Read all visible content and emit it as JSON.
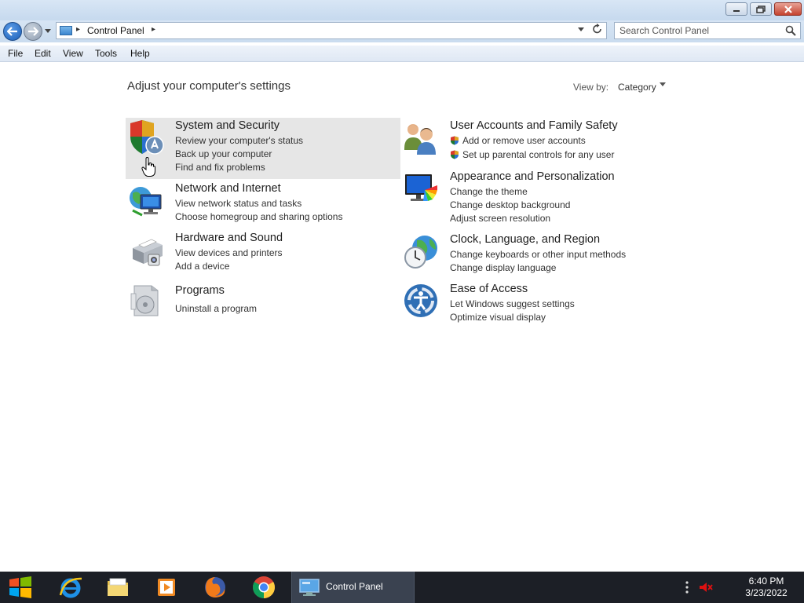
{
  "window": {
    "minimize_icon": "minimize-icon",
    "maximize_icon": "restore-icon",
    "close_icon": "close-icon"
  },
  "nav": {
    "back_icon": "back-arrow-icon",
    "forward_icon": "forward-arrow-icon",
    "recent_icon": "chevron-down-icon",
    "breadcrumb": "Control Panel",
    "refresh_icon": "refresh-icon",
    "search_placeholder": "Search Control Panel",
    "search_value": ""
  },
  "menu": {
    "items": [
      "File",
      "Edit",
      "View",
      "Tools",
      "Help"
    ]
  },
  "main": {
    "heading": "Adjust your computer's settings",
    "view_by_label": "View by:",
    "view_by_value": "Category",
    "categories": [
      {
        "title": "System and Security",
        "icon": "shield-icon",
        "links": [
          "Review your computer's status",
          "Back up your computer",
          "Find and fix problems"
        ]
      },
      {
        "title": "Network and Internet",
        "icon": "network-icon",
        "links": [
          "View network status and tasks",
          "Choose homegroup and sharing options"
        ]
      },
      {
        "title": "Hardware and Sound",
        "icon": "printer-icon",
        "links": [
          "View devices and printers",
          "Add a device"
        ]
      },
      {
        "title": "Programs",
        "icon": "programs-icon",
        "links": [
          "Uninstall a program"
        ]
      },
      {
        "title": "User Accounts and Family Safety",
        "icon": "users-icon",
        "links": [
          "Add or remove user accounts",
          "Set up parental controls for any user"
        ]
      },
      {
        "title": "Appearance and Personalization",
        "icon": "monitor-icon",
        "links": [
          "Change the theme",
          "Change desktop background",
          "Adjust screen resolution"
        ]
      },
      {
        "title": "Clock, Language, and Region",
        "icon": "clock-globe-icon",
        "links": [
          "Change keyboards or other input methods",
          "Change display language"
        ]
      },
      {
        "title": "Ease of Access",
        "icon": "ease-of-access-icon",
        "links": [
          "Let Windows suggest settings",
          "Optimize visual display"
        ]
      }
    ]
  },
  "taskbar": {
    "start_icon": "windows-logo-icon",
    "pinned": [
      "internet-explorer-icon",
      "file-explorer-icon",
      "media-player-icon",
      "firefox-icon",
      "chrome-icon"
    ],
    "active_window_label": "Control Panel",
    "tray_icons": [
      "tray-overflow-icon",
      "volume-muted-icon"
    ],
    "time": "6:40 PM",
    "date": "3/23/2022"
  },
  "colors": {
    "taskbar": "#1c1f26",
    "hover_highlight": "#e6e6e6",
    "title_bar": "#d8e6f5"
  }
}
